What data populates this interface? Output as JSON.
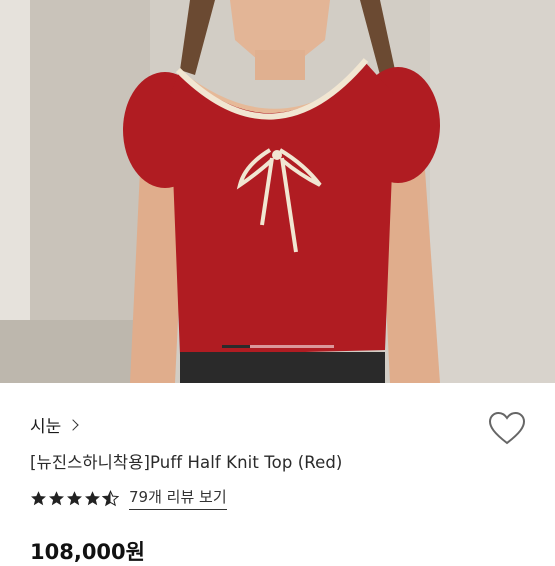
{
  "product": {
    "brand": "시눈",
    "title": "[뉴진스하니착용]Puff Half Knit Top (Red)",
    "rating": 4.5,
    "review_link": "79개 리뷰 보기",
    "price": "108,000원"
  },
  "gallery": {
    "current_slide_fraction": 0.25
  },
  "colors": {
    "knit_red": "#b01c22",
    "trim_cream": "#f1e6d2",
    "star": "#222222"
  },
  "icons": {
    "chevron": "chevron-right-icon",
    "heart": "heart-outline-icon",
    "star": "star-icon"
  }
}
